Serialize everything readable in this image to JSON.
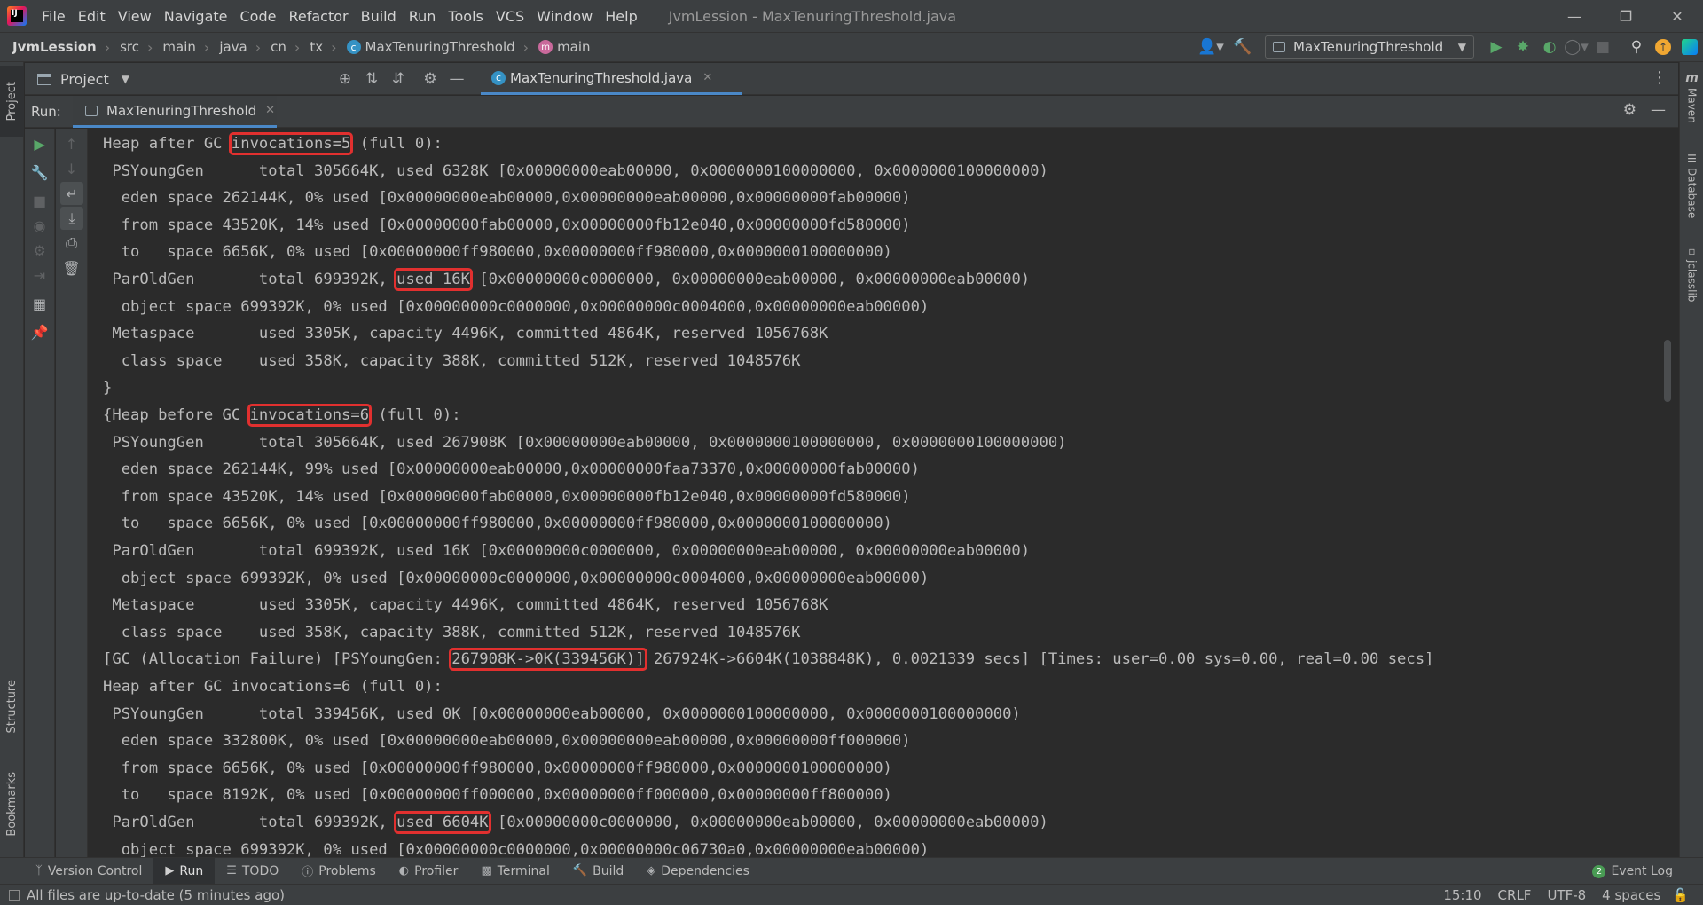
{
  "app": {
    "logo_letters": "IJ",
    "menu": [
      "File",
      "Edit",
      "View",
      "Navigate",
      "Code",
      "Refactor",
      "Build",
      "Run",
      "Tools",
      "VCS",
      "Window",
      "Help"
    ],
    "window_title": "JvmLession - MaxTenuringThreshold.java"
  },
  "breadcrumb": {
    "project": "JvmLession",
    "parts": [
      "src",
      "main",
      "java",
      "cn",
      "tx"
    ],
    "class_name": "MaxTenuringThreshold",
    "method_name": "main"
  },
  "toolbar": {
    "run_config": "MaxTenuringThreshold"
  },
  "left_stripe": {
    "project": "Project",
    "structure": "Structure",
    "bookmarks": "Bookmarks"
  },
  "right_stripe": {
    "maven": "Maven",
    "database": "Database",
    "jclasslib": "jclasslib"
  },
  "project_panel": {
    "title": "Project"
  },
  "editor": {
    "tab_label": "MaxTenuringThreshold.java"
  },
  "run_panel": {
    "label": "Run:",
    "tab_label": "MaxTenuringThreshold"
  },
  "console": {
    "lines": [
      {
        "pre": "Heap after GC ",
        "hl": "invocations=5",
        "post": " (full 0):"
      },
      {
        "pre": " PSYoungGen      total 305664K, used 6328K [0x00000000eab00000, 0x0000000100000000, 0x0000000100000000)"
      },
      {
        "pre": "  eden space 262144K, 0% used [0x00000000eab00000,0x00000000eab00000,0x00000000fab00000)"
      },
      {
        "pre": "  from space 43520K, 14% used [0x00000000fab00000,0x00000000fb12e040,0x00000000fd580000)"
      },
      {
        "pre": "  to   space 6656K, 0% used [0x00000000ff980000,0x00000000ff980000,0x0000000100000000)"
      },
      {
        "pre": " ParOldGen       total 699392K, ",
        "hl": "used 16K",
        "post": " [0x00000000c0000000, 0x00000000eab00000, 0x00000000eab00000)"
      },
      {
        "pre": "  object space 699392K, 0% used [0x00000000c0000000,0x00000000c0004000,0x00000000eab00000)"
      },
      {
        "pre": " Metaspace       used 3305K, capacity 4496K, committed 4864K, reserved 1056768K"
      },
      {
        "pre": "  class space    used 358K, capacity 388K, committed 512K, reserved 1048576K"
      },
      {
        "pre": "}"
      },
      {
        "pre": "{Heap before GC ",
        "hl": "invocations=6",
        "post": " (full 0):"
      },
      {
        "pre": " PSYoungGen      total 305664K, used 267908K [0x00000000eab00000, 0x0000000100000000, 0x0000000100000000)"
      },
      {
        "pre": "  eden space 262144K, 99% used [0x00000000eab00000,0x00000000faa73370,0x00000000fab00000)"
      },
      {
        "pre": "  from space 43520K, 14% used [0x00000000fab00000,0x00000000fb12e040,0x00000000fd580000)"
      },
      {
        "pre": "  to   space 6656K, 0% used [0x00000000ff980000,0x00000000ff980000,0x0000000100000000)"
      },
      {
        "pre": " ParOldGen       total 699392K, used 16K [0x00000000c0000000, 0x00000000eab00000, 0x00000000eab00000)"
      },
      {
        "pre": "  object space 699392K, 0% used [0x00000000c0000000,0x00000000c0004000,0x00000000eab00000)"
      },
      {
        "pre": " Metaspace       used 3305K, capacity 4496K, committed 4864K, reserved 1056768K"
      },
      {
        "pre": "  class space    used 358K, capacity 388K, committed 512K, reserved 1048576K"
      },
      {
        "pre": "[GC (Allocation Failure) [PSYoungGen: ",
        "hl": "267908K->0K(339456K)]",
        "post": " 267924K->6604K(1038848K), 0.0021339 secs] [Times: user=0.00 sys=0.00, real=0.00 secs]"
      },
      {
        "pre": "Heap after GC invocations=6 (full 0):"
      },
      {
        "pre": " PSYoungGen      total 339456K, used 0K [0x00000000eab00000, 0x0000000100000000, 0x0000000100000000)"
      },
      {
        "pre": "  eden space 332800K, 0% used [0x00000000eab00000,0x00000000eab00000,0x00000000ff000000)"
      },
      {
        "pre": "  from space 6656K, 0% used [0x00000000ff980000,0x00000000ff980000,0x0000000100000000)"
      },
      {
        "pre": "  to   space 8192K, 0% used [0x00000000ff000000,0x00000000ff000000,0x00000000ff800000)"
      },
      {
        "pre": " ParOldGen       total 699392K, ",
        "hl": "used 6604K",
        "post": " [0x00000000c0000000, 0x00000000eab00000, 0x00000000eab00000)"
      },
      {
        "pre": "  object space 699392K, 0% used [0x00000000c0000000,0x00000000c06730a0,0x00000000eab00000)"
      }
    ]
  },
  "bottom_tabs": [
    "Version Control",
    "Run",
    "TODO",
    "Problems",
    "Profiler",
    "Terminal",
    "Build",
    "Dependencies"
  ],
  "event_log": {
    "count": "2",
    "label": "Event Log"
  },
  "status": {
    "message": "All files are up-to-date (5 minutes ago)",
    "position": "15:10",
    "line_sep": "CRLF",
    "encoding": "UTF-8",
    "indent": "4 spaces"
  },
  "colors": {
    "highlight_box": "#e1302f",
    "accent_tab": "#4a88c7",
    "run_green": "#59a869"
  }
}
